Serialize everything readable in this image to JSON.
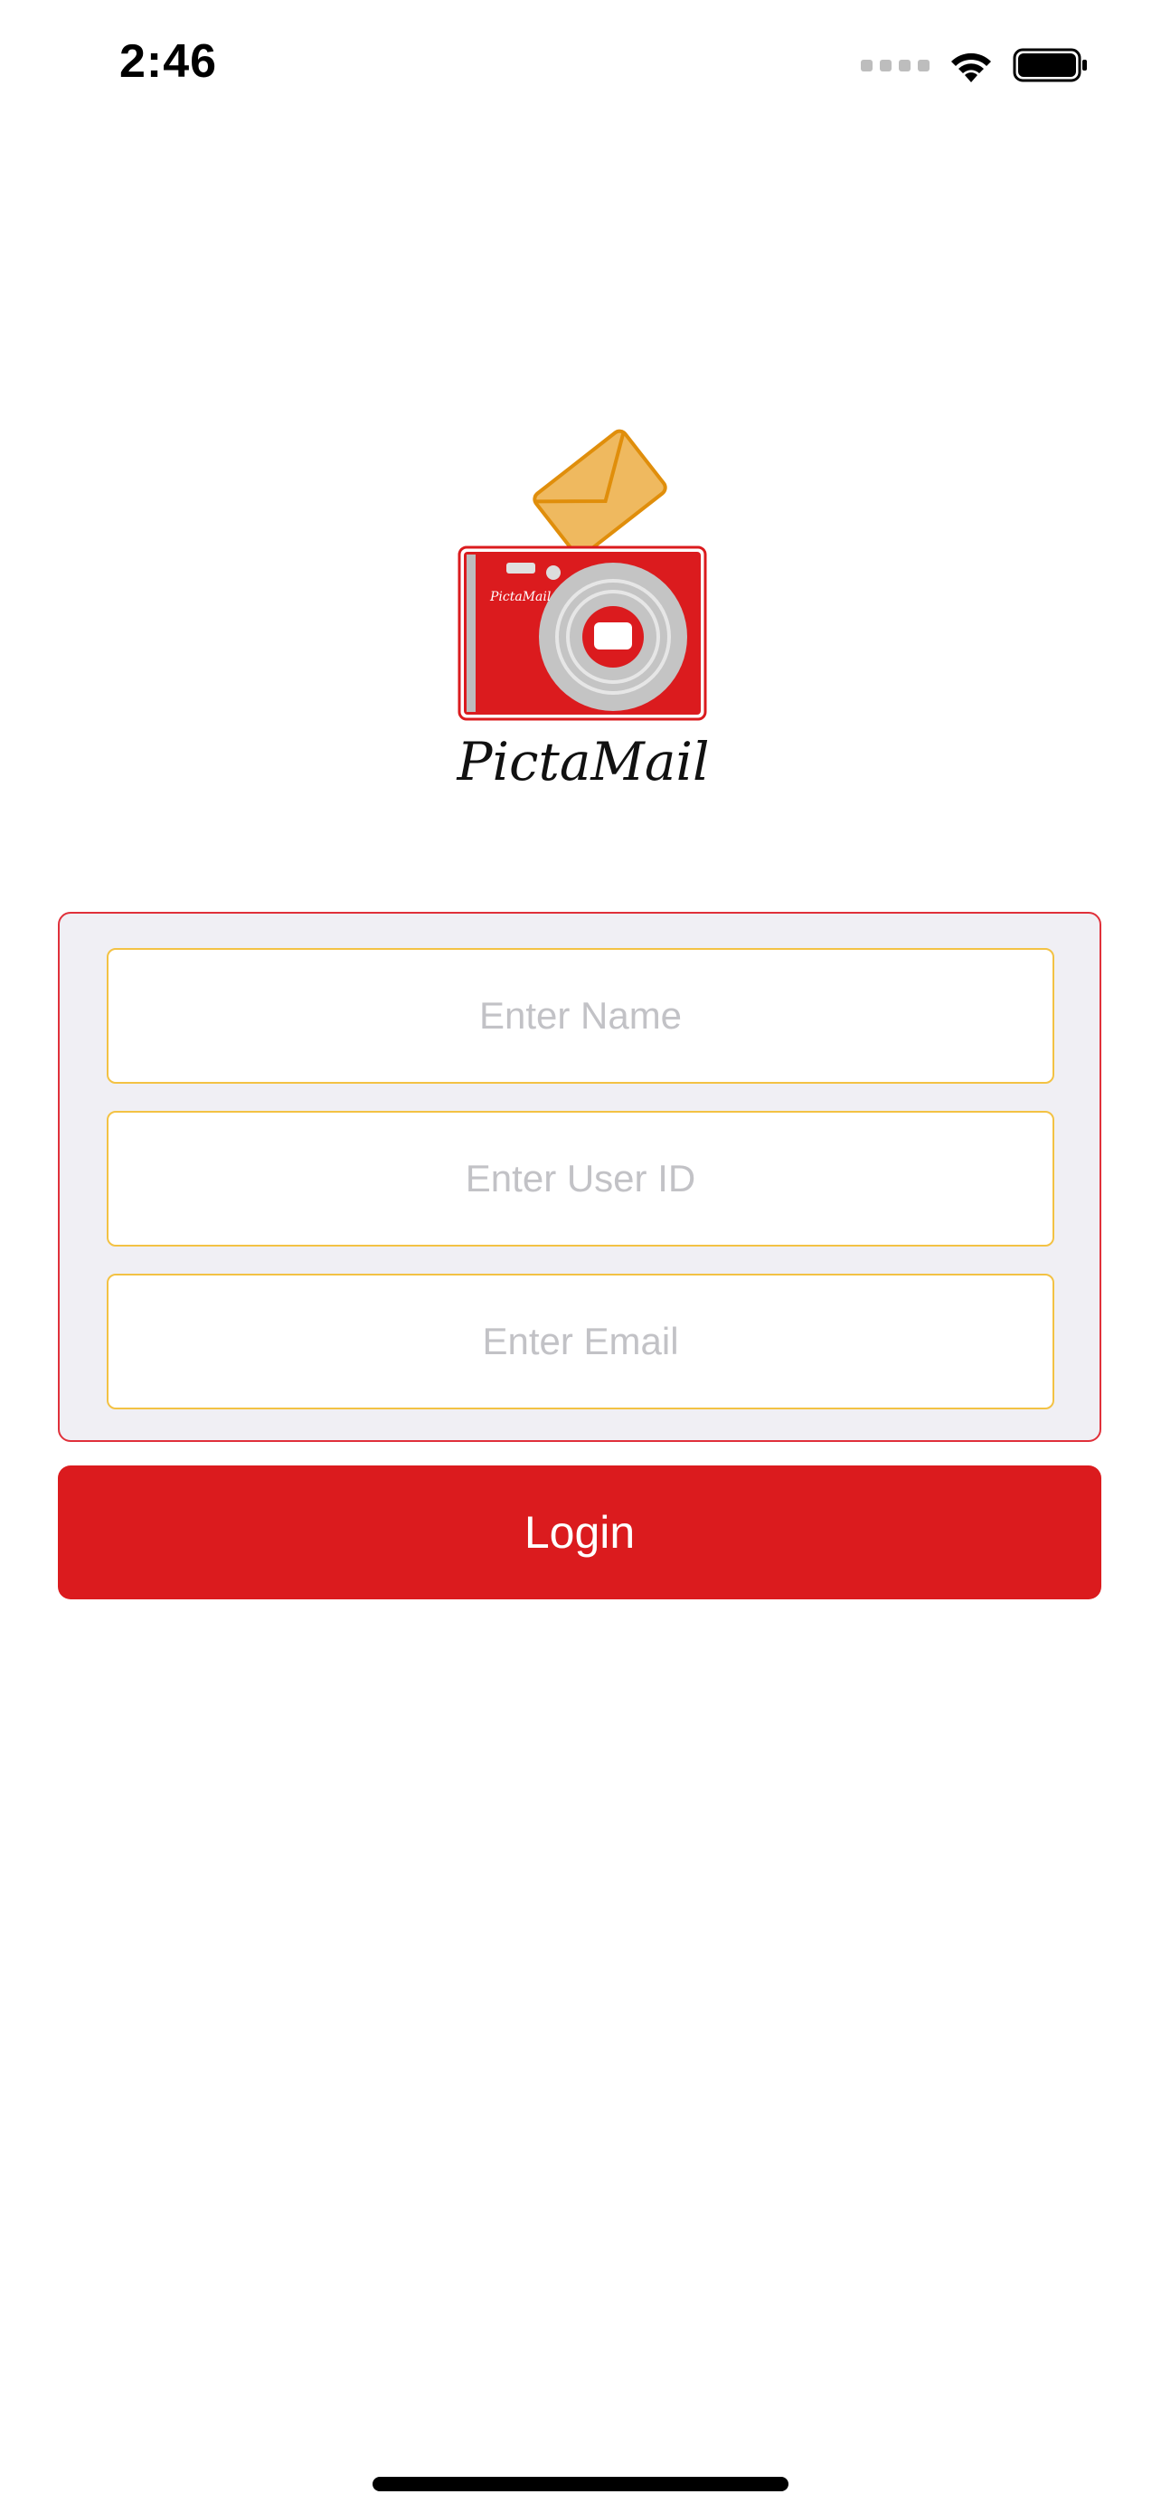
{
  "status_bar": {
    "time": "2:46",
    "icons": [
      "signal-dots-icon",
      "wifi-icon",
      "battery-icon"
    ]
  },
  "logo": {
    "text": "PictaMail",
    "camera_label": "PictaMail",
    "colors": {
      "camera_red": "#db1b1e",
      "envelope": "#efb95f",
      "envelope_stroke": "#e08e0b",
      "lens_gray": "#c4c4c4"
    }
  },
  "form": {
    "name_placeholder": "Enter Name",
    "user_id_placeholder": "Enter User ID",
    "email_placeholder": "Enter Email"
  },
  "actions": {
    "login_label": "Login"
  },
  "theme": {
    "accent": "#db1b1e",
    "field_border": "#f3c244",
    "card_bg": "#f0eff4"
  }
}
